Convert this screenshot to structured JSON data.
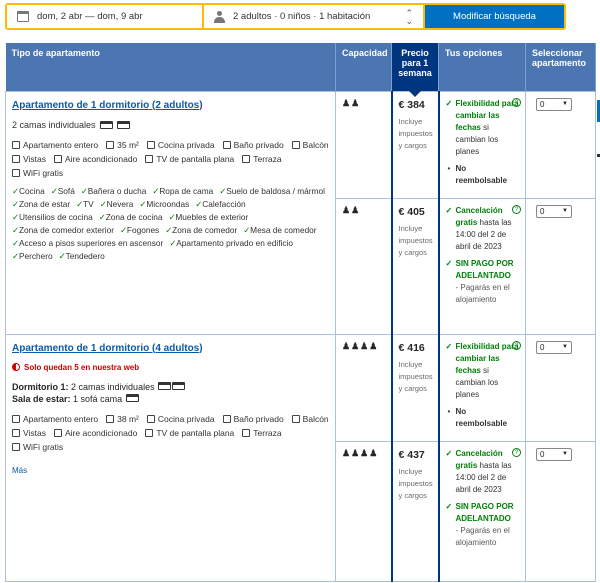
{
  "search": {
    "dates": "dom, 2 abr — dom, 9 abr",
    "guests": "2 adultos · 0 niños · 1 habitación",
    "button": "Modificar búsqueda"
  },
  "headers": {
    "type": "Tipo de apartamento",
    "capacity": "Capacidad",
    "price": "Precio para 1 semana",
    "options": "Tus opciones",
    "select": "Seleccionar apartamento"
  },
  "room1": {
    "name": "Apartamento de 1 dormitorio (2 adultos)",
    "beds": "2 camas individuales",
    "facilities": [
      "Apartamento entero",
      "35 m²",
      "Cocina privada",
      "Baño privado",
      "Balcón",
      "Vistas",
      "Aire acondicionado",
      "TV de pantalla plana",
      "Terraza",
      "WiFi gratis"
    ],
    "amenities": [
      "Cocina",
      "Sofá",
      "Bañera o ducha",
      "Ropa de cama",
      "Suelo de baldosa / mármol",
      "Zona de estar",
      "TV",
      "Nevera",
      "Microondas",
      "Calefacción",
      "Utensilios de cocina",
      "Zona de cocina",
      "Muebles de exterior",
      "Zona de comedor exterior",
      "Fogones",
      "Zona de comedor",
      "Mesa de comedor",
      "Acceso a pisos superiores en ascensor",
      "Apartamento privado en edificio",
      "Perchero",
      "Tendedero"
    ],
    "options": [
      {
        "capacity": "2",
        "price": "€ 384",
        "price_note": "Incluye impuestos y cargos",
        "lines": [
          {
            "mark": "check",
            "strong": "Flexibilidad para cambiar las fechas",
            "rest": " si cambian los planes"
          },
          {
            "mark": "bullet",
            "strong": "No reembolsable",
            "rest": ""
          }
        ],
        "select_value": "0"
      },
      {
        "capacity": "2",
        "price": "€ 405",
        "price_note": "Incluye impuestos y cargos",
        "lines": [
          {
            "mark": "check",
            "strong": "Cancelación gratis",
            "rest": " hasta las 14:00 del 2 de abril de 2023"
          },
          {
            "mark": "check",
            "strong": "SIN PAGO POR ADELANTADO",
            "rest": "",
            "sub": "- Pagarás en el alojamiento"
          }
        ],
        "select_value": "0"
      }
    ]
  },
  "room2": {
    "name": "Apartamento de 1 dormitorio (4 adultos)",
    "urgent": "Solo quedan 5 en nuestra web",
    "bedroom_label": "Dormitorio 1:",
    "bedroom_beds": "2 camas individuales",
    "living_label": "Sala de estar:",
    "living_beds": "1 sofá cama",
    "facilities": [
      "Apartamento entero",
      "38 m²",
      "Cocina privada",
      "Baño privado",
      "Balcón",
      "Vistas",
      "Aire acondicionado",
      "TV de pantalla plana",
      "Terraza",
      "WiFi gratis"
    ],
    "more": "Más",
    "options": [
      {
        "capacity": "4",
        "price": "€ 416",
        "price_note": "Incluye impuestos y cargos",
        "lines": [
          {
            "mark": "check",
            "strong": "Flexibilidad para cambiar las fechas",
            "rest": " si cambian los planes"
          },
          {
            "mark": "bullet",
            "strong": "No reembolsable",
            "rest": ""
          }
        ],
        "select_value": "0"
      },
      {
        "capacity": "4",
        "price": "€ 437",
        "price_note": "Incluye impuestos y cargos",
        "lines": [
          {
            "mark": "check",
            "strong": "Cancelación gratis",
            "rest": " hasta las 14:00 del 2 de abril de 2023"
          },
          {
            "mark": "check",
            "strong": "SIN PAGO POR ADELANTADO",
            "rest": "",
            "sub": "- Pagarás en el alojamiento"
          }
        ],
        "select_value": "0"
      }
    ]
  }
}
